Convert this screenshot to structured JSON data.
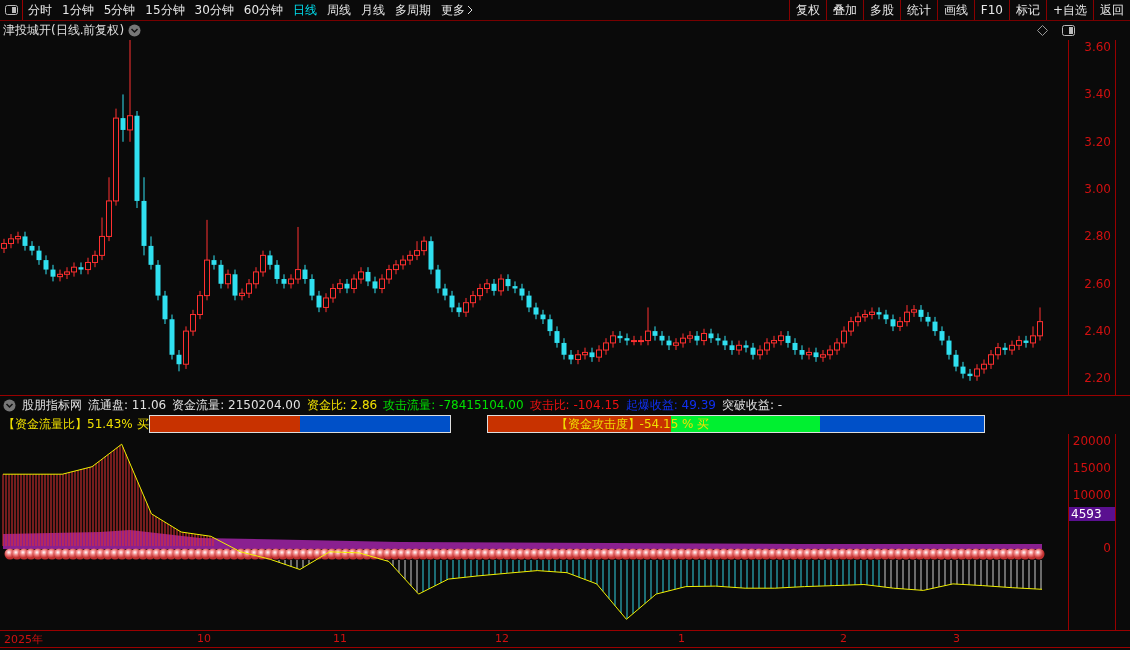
{
  "toolbar": {
    "periods": [
      {
        "label": "分时",
        "selected": false
      },
      {
        "label": "1分钟",
        "selected": false
      },
      {
        "label": "5分钟",
        "selected": false
      },
      {
        "label": "15分钟",
        "selected": false
      },
      {
        "label": "30分钟",
        "selected": false
      },
      {
        "label": "60分钟",
        "selected": false
      },
      {
        "label": "日线",
        "selected": true
      },
      {
        "label": "周线",
        "selected": false
      },
      {
        "label": "月线",
        "selected": false
      },
      {
        "label": "多周期",
        "selected": false
      },
      {
        "label": "更多",
        "selected": false
      }
    ],
    "buttons": [
      "复权",
      "叠加",
      "多股",
      "统计",
      "画线",
      "F10",
      "标记",
      "+自选",
      "返回"
    ]
  },
  "chart": {
    "title": "津投城开(日线.前复权)",
    "chart_data": {
      "type": "candlestick",
      "ylim": [
        2.13,
        3.63
      ],
      "yticks": [
        {
          "value": 3.6,
          "label": "3.60"
        },
        {
          "value": 3.4,
          "label": "3.40"
        },
        {
          "value": 3.2,
          "label": "3.20"
        },
        {
          "value": 3.0,
          "label": "3.00"
        },
        {
          "value": 2.8,
          "label": "2.80"
        },
        {
          "value": 2.6,
          "label": "2.60"
        },
        {
          "value": 2.4,
          "label": "2.40"
        },
        {
          "value": 2.2,
          "label": "2.20"
        }
      ],
      "ohlc": [
        [
          2.75,
          2.79,
          2.73,
          2.77
        ],
        [
          2.77,
          2.81,
          2.75,
          2.79
        ],
        [
          2.79,
          2.82,
          2.77,
          2.8
        ],
        [
          2.8,
          2.82,
          2.74,
          2.76
        ],
        [
          2.76,
          2.78,
          2.72,
          2.74
        ],
        [
          2.74,
          2.76,
          2.68,
          2.7
        ],
        [
          2.7,
          2.72,
          2.64,
          2.66
        ],
        [
          2.66,
          2.68,
          2.61,
          2.63
        ],
        [
          2.63,
          2.66,
          2.61,
          2.64
        ],
        [
          2.64,
          2.67,
          2.62,
          2.65
        ],
        [
          2.65,
          2.69,
          2.63,
          2.67
        ],
        [
          2.67,
          2.69,
          2.64,
          2.66
        ],
        [
          2.66,
          2.71,
          2.64,
          2.69
        ],
        [
          2.69,
          2.74,
          2.67,
          2.72
        ],
        [
          2.72,
          2.88,
          2.7,
          2.8
        ],
        [
          2.8,
          3.05,
          2.78,
          2.95
        ],
        [
          2.95,
          3.34,
          2.93,
          3.3
        ],
        [
          3.3,
          3.4,
          3.2,
          3.25
        ],
        [
          3.25,
          3.63,
          3.2,
          3.31
        ],
        [
          3.31,
          3.33,
          2.92,
          2.95
        ],
        [
          2.95,
          3.05,
          2.72,
          2.76
        ],
        [
          2.76,
          2.8,
          2.66,
          2.68
        ],
        [
          2.68,
          2.7,
          2.53,
          2.55
        ],
        [
          2.55,
          2.57,
          2.43,
          2.45
        ],
        [
          2.45,
          2.47,
          2.28,
          2.3
        ],
        [
          2.3,
          2.32,
          2.23,
          2.26
        ],
        [
          2.26,
          2.42,
          2.24,
          2.4
        ],
        [
          2.4,
          2.49,
          2.38,
          2.47
        ],
        [
          2.47,
          2.57,
          2.45,
          2.55
        ],
        [
          2.55,
          2.87,
          2.53,
          2.7
        ],
        [
          2.7,
          2.72,
          2.66,
          2.68
        ],
        [
          2.68,
          2.7,
          2.58,
          2.6
        ],
        [
          2.6,
          2.66,
          2.58,
          2.64
        ],
        [
          2.64,
          2.66,
          2.53,
          2.55
        ],
        [
          2.55,
          2.58,
          2.53,
          2.56
        ],
        [
          2.56,
          2.62,
          2.54,
          2.6
        ],
        [
          2.6,
          2.67,
          2.58,
          2.65
        ],
        [
          2.65,
          2.74,
          2.63,
          2.72
        ],
        [
          2.72,
          2.74,
          2.66,
          2.68
        ],
        [
          2.68,
          2.7,
          2.6,
          2.62
        ],
        [
          2.62,
          2.64,
          2.58,
          2.6
        ],
        [
          2.6,
          2.64,
          2.58,
          2.62
        ],
        [
          2.62,
          2.84,
          2.6,
          2.66
        ],
        [
          2.66,
          2.68,
          2.6,
          2.62
        ],
        [
          2.62,
          2.64,
          2.53,
          2.55
        ],
        [
          2.55,
          2.57,
          2.48,
          2.5
        ],
        [
          2.5,
          2.56,
          2.48,
          2.54
        ],
        [
          2.54,
          2.6,
          2.52,
          2.58
        ],
        [
          2.58,
          2.62,
          2.56,
          2.6
        ],
        [
          2.6,
          2.62,
          2.56,
          2.58
        ],
        [
          2.58,
          2.64,
          2.56,
          2.62
        ],
        [
          2.62,
          2.67,
          2.6,
          2.65
        ],
        [
          2.65,
          2.67,
          2.59,
          2.61
        ],
        [
          2.61,
          2.63,
          2.56,
          2.58
        ],
        [
          2.58,
          2.64,
          2.56,
          2.62
        ],
        [
          2.62,
          2.68,
          2.6,
          2.66
        ],
        [
          2.66,
          2.7,
          2.64,
          2.68
        ],
        [
          2.68,
          2.72,
          2.66,
          2.7
        ],
        [
          2.7,
          2.74,
          2.68,
          2.72
        ],
        [
          2.72,
          2.78,
          2.7,
          2.74
        ],
        [
          2.74,
          2.8,
          2.72,
          2.78
        ],
        [
          2.78,
          2.8,
          2.64,
          2.66
        ],
        [
          2.66,
          2.68,
          2.56,
          2.58
        ],
        [
          2.58,
          2.6,
          2.53,
          2.55
        ],
        [
          2.55,
          2.57,
          2.48,
          2.5
        ],
        [
          2.5,
          2.52,
          2.46,
          2.48
        ],
        [
          2.48,
          2.54,
          2.46,
          2.52
        ],
        [
          2.52,
          2.57,
          2.5,
          2.55
        ],
        [
          2.55,
          2.6,
          2.53,
          2.58
        ],
        [
          2.58,
          2.62,
          2.56,
          2.6
        ],
        [
          2.6,
          2.62,
          2.55,
          2.57
        ],
        [
          2.57,
          2.64,
          2.55,
          2.62
        ],
        [
          2.62,
          2.64,
          2.57,
          2.59
        ],
        [
          2.59,
          2.61,
          2.56,
          2.58
        ],
        [
          2.58,
          2.6,
          2.53,
          2.55
        ],
        [
          2.55,
          2.57,
          2.48,
          2.5
        ],
        [
          2.5,
          2.52,
          2.45,
          2.47
        ],
        [
          2.47,
          2.49,
          2.43,
          2.45
        ],
        [
          2.45,
          2.47,
          2.38,
          2.4
        ],
        [
          2.4,
          2.42,
          2.33,
          2.35
        ],
        [
          2.35,
          2.37,
          2.28,
          2.3
        ],
        [
          2.3,
          2.32,
          2.26,
          2.28
        ],
        [
          2.28,
          2.32,
          2.26,
          2.3
        ],
        [
          2.3,
          2.33,
          2.28,
          2.31
        ],
        [
          2.31,
          2.33,
          2.27,
          2.29
        ],
        [
          2.29,
          2.34,
          2.27,
          2.32
        ],
        [
          2.32,
          2.37,
          2.3,
          2.35
        ],
        [
          2.35,
          2.4,
          2.33,
          2.38
        ],
        [
          2.38,
          2.4,
          2.35,
          2.37
        ],
        [
          2.37,
          2.39,
          2.34,
          2.36
        ],
        [
          2.36,
          2.38,
          2.34,
          2.36
        ],
        [
          2.36,
          2.38,
          2.34,
          2.36
        ],
        [
          2.36,
          2.5,
          2.34,
          2.4
        ],
        [
          2.4,
          2.42,
          2.36,
          2.38
        ],
        [
          2.38,
          2.4,
          2.34,
          2.36
        ],
        [
          2.36,
          2.38,
          2.32,
          2.34
        ],
        [
          2.34,
          2.37,
          2.32,
          2.35
        ],
        [
          2.35,
          2.39,
          2.33,
          2.37
        ],
        [
          2.37,
          2.4,
          2.35,
          2.38
        ],
        [
          2.38,
          2.4,
          2.34,
          2.36
        ],
        [
          2.36,
          2.41,
          2.34,
          2.39
        ],
        [
          2.39,
          2.41,
          2.35,
          2.37
        ],
        [
          2.37,
          2.39,
          2.34,
          2.36
        ],
        [
          2.36,
          2.38,
          2.32,
          2.34
        ],
        [
          2.34,
          2.36,
          2.3,
          2.32
        ],
        [
          2.32,
          2.36,
          2.3,
          2.34
        ],
        [
          2.34,
          2.36,
          2.31,
          2.33
        ],
        [
          2.33,
          2.35,
          2.28,
          2.3
        ],
        [
          2.3,
          2.34,
          2.28,
          2.32
        ],
        [
          2.32,
          2.37,
          2.3,
          2.35
        ],
        [
          2.35,
          2.38,
          2.33,
          2.36
        ],
        [
          2.36,
          2.4,
          2.34,
          2.38
        ],
        [
          2.38,
          2.4,
          2.33,
          2.35
        ],
        [
          2.35,
          2.37,
          2.3,
          2.32
        ],
        [
          2.32,
          2.34,
          2.28,
          2.3
        ],
        [
          2.3,
          2.33,
          2.28,
          2.31
        ],
        [
          2.31,
          2.33,
          2.27,
          2.29
        ],
        [
          2.29,
          2.32,
          2.27,
          2.3
        ],
        [
          2.3,
          2.34,
          2.28,
          2.32
        ],
        [
          2.32,
          2.37,
          2.3,
          2.35
        ],
        [
          2.35,
          2.42,
          2.33,
          2.4
        ],
        [
          2.4,
          2.46,
          2.38,
          2.44
        ],
        [
          2.44,
          2.48,
          2.42,
          2.46
        ],
        [
          2.46,
          2.49,
          2.44,
          2.47
        ],
        [
          2.47,
          2.5,
          2.45,
          2.48
        ],
        [
          2.48,
          2.5,
          2.45,
          2.47
        ],
        [
          2.47,
          2.49,
          2.43,
          2.45
        ],
        [
          2.45,
          2.47,
          2.4,
          2.42
        ],
        [
          2.42,
          2.46,
          2.4,
          2.44
        ],
        [
          2.44,
          2.51,
          2.42,
          2.48
        ],
        [
          2.48,
          2.51,
          2.46,
          2.49
        ],
        [
          2.49,
          2.51,
          2.44,
          2.46
        ],
        [
          2.46,
          2.48,
          2.42,
          2.44
        ],
        [
          2.44,
          2.46,
          2.38,
          2.4
        ],
        [
          2.4,
          2.42,
          2.34,
          2.36
        ],
        [
          2.36,
          2.38,
          2.28,
          2.3
        ],
        [
          2.3,
          2.32,
          2.23,
          2.25
        ],
        [
          2.25,
          2.27,
          2.2,
          2.22
        ],
        [
          2.22,
          2.24,
          2.19,
          2.21
        ],
        [
          2.21,
          2.26,
          2.19,
          2.24
        ],
        [
          2.24,
          2.28,
          2.22,
          2.26
        ],
        [
          2.26,
          2.32,
          2.24,
          2.3
        ],
        [
          2.3,
          2.35,
          2.28,
          2.33
        ],
        [
          2.33,
          2.35,
          2.3,
          2.32
        ],
        [
          2.32,
          2.36,
          2.3,
          2.34
        ],
        [
          2.34,
          2.38,
          2.32,
          2.36
        ],
        [
          2.36,
          2.38,
          2.33,
          2.35
        ],
        [
          2.35,
          2.42,
          2.33,
          2.38
        ],
        [
          2.38,
          2.5,
          2.36,
          2.44
        ]
      ]
    }
  },
  "indicator": {
    "name": "股朋指标网",
    "stats": [
      {
        "text": "流通盘: 11.06",
        "color": "#e0e0e0"
      },
      {
        "text": "资金流量: 2150204.00",
        "color": "#e0e0e0"
      },
      {
        "text": "资金比: 2.86",
        "color": "#f0e000"
      },
      {
        "text": "攻击流量: -78415104.00",
        "color": "#00e000"
      },
      {
        "text": "攻击比: -104.15",
        "color": "#f01010"
      },
      {
        "text": "起爆收益: 49.39",
        "color": "#1030f0"
      },
      {
        "text": "突破收益: -",
        "color": "#e0e0e0"
      }
    ],
    "bars": [
      {
        "label": "【资金流量比】51.43% 买",
        "kind": "label_outside",
        "segments": [
          {
            "color": "#c83200",
            "level": 0.5
          },
          {
            "color": "#0050c8",
            "level": 0.5
          }
        ]
      },
      {
        "label": "【资金攻击度】-54.15 % 买",
        "kind": "label_inside",
        "segments": [
          {
            "color": "#c83200",
            "level": 0.37
          },
          {
            "color": "#00f030"
          },
          {
            "color": "#0050c8",
            "level": 0.33
          }
        ]
      }
    ],
    "chart_data": {
      "type": "line",
      "ylim": [
        -15300,
        21300
      ],
      "yticks": [
        20000,
        15000,
        10000,
        0
      ],
      "series": [
        {
          "color": "#f0f000",
          "values": [
            13800,
            13800,
            13800,
            15200,
            19400,
            6400,
            3000,
            2200,
            -700,
            -2100,
            -4000,
            -700,
            -900,
            -2500,
            -8600,
            -5800,
            -5200,
            -4700,
            -4200,
            -4600,
            -6700,
            -13300,
            -8600,
            -7200,
            -7100,
            -7500,
            -7500,
            -7200,
            -7000,
            -6800,
            -7500,
            -7900,
            -6700,
            -7000,
            -7400,
            -7700
          ]
        }
      ]
    },
    "tag": "4593"
  },
  "date_axis": [
    "2025年",
    "10",
    "11",
    "12",
    "1",
    "2",
    "3"
  ]
}
